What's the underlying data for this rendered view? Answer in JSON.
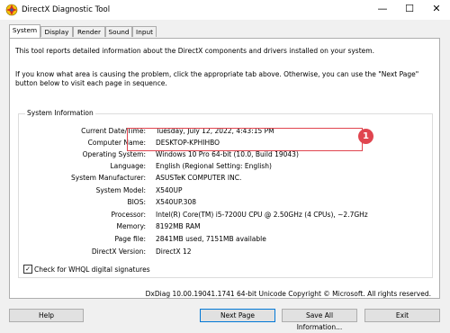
{
  "window": {
    "title": "DirectX Diagnostic Tool",
    "minimize_glyph": "—",
    "maximize_glyph": "☐",
    "close_glyph": "✕"
  },
  "tabs": [
    {
      "label": "System",
      "active": true
    },
    {
      "label": "Display",
      "active": false
    },
    {
      "label": "Render",
      "active": false
    },
    {
      "label": "Sound",
      "active": false
    },
    {
      "label": "Input",
      "active": false
    }
  ],
  "intro": {
    "line1": "This tool reports detailed information about the DirectX components and drivers installed on your system.",
    "line2": "If you know what area is causing the problem, click the appropriate tab above.  Otherwise, you can use the \"Next Page\" button below to visit each page in sequence."
  },
  "system_info": {
    "group_title": "System Information",
    "rows": [
      {
        "label": "Current Date/Time:",
        "value": "Tuesday, July 12, 2022, 4:43:15 PM"
      },
      {
        "label": "Computer Name:",
        "value": "DESKTOP-KPHIHBO"
      },
      {
        "label": "Operating System:",
        "value": "Windows 10 Pro 64-bit (10.0, Build 19043)"
      },
      {
        "label": "Language:",
        "value": "English (Regional Setting: English)"
      },
      {
        "label": "System Manufacturer:",
        "value": "ASUSTeK COMPUTER INC."
      },
      {
        "label": "System Model:",
        "value": "X540UP"
      },
      {
        "label": "BIOS:",
        "value": "X540UP.308"
      },
      {
        "label": "Processor:",
        "value": "Intel(R) Core(TM) i5-7200U CPU @ 2.50GHz (4 CPUs), ~2.7GHz"
      },
      {
        "label": "Memory:",
        "value": "8192MB RAM"
      },
      {
        "label": "Page file:",
        "value": "2841MB used, 7151MB available"
      },
      {
        "label": "DirectX Version:",
        "value": "DirectX 12"
      }
    ]
  },
  "annotation": {
    "badge_number": "1",
    "color": "#e0454f"
  },
  "whql": {
    "label": "Check for WHQL digital signatures",
    "checked": true,
    "check_glyph": "✓"
  },
  "footer_text": "DxDiag 10.00.19041.1741 64-bit Unicode  Copyright © Microsoft. All rights reserved.",
  "buttons": {
    "help": "Help",
    "next_page": "Next Page",
    "save_all": "Save All Information...",
    "exit": "Exit"
  },
  "icons": {
    "app": "directx-icon"
  },
  "colors": {
    "accent": "#0078d7",
    "highlight": "#e0454f"
  }
}
